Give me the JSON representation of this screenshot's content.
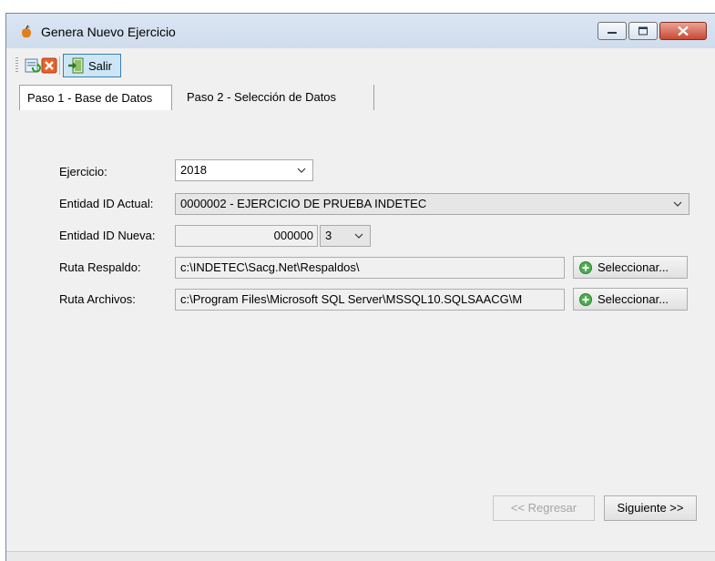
{
  "window": {
    "title": "Genera Nuevo Ejercicio"
  },
  "toolbar": {
    "salir_label": "Salir"
  },
  "tabs": [
    {
      "label": "Paso 1 - Base de Datos",
      "active": true
    },
    {
      "label": "Paso 2 - Selección de Datos",
      "active": false
    }
  ],
  "form": {
    "ejercicio_label": "Ejercicio:",
    "ejercicio_value": "2018",
    "entidad_actual_label": "Entidad ID Actual:",
    "entidad_actual_value": "0000002 - EJERCICIO DE PRUEBA INDETEC",
    "entidad_nueva_label": "Entidad ID Nueva:",
    "entidad_nueva_value": "000000",
    "entidad_nueva_digits": "3",
    "ruta_respaldo_label": "Ruta Respaldo:",
    "ruta_respaldo_value": "c:\\INDETEC\\Sacg.Net\\Respaldos\\",
    "ruta_archivos_label": "Ruta Archivos:",
    "ruta_archivos_value": "c:\\Program Files\\Microsoft SQL Server\\MSSQL10.SQLSAACG\\M",
    "seleccionar_label": "Seleccionar..."
  },
  "nav": {
    "regresar_label": "<< Regresar",
    "siguiente_label": "Siguiente >>"
  },
  "colors": {
    "titlebar": "#dbe6f3",
    "close_button": "#c94a33",
    "selected_tool": "#cde6f7"
  }
}
